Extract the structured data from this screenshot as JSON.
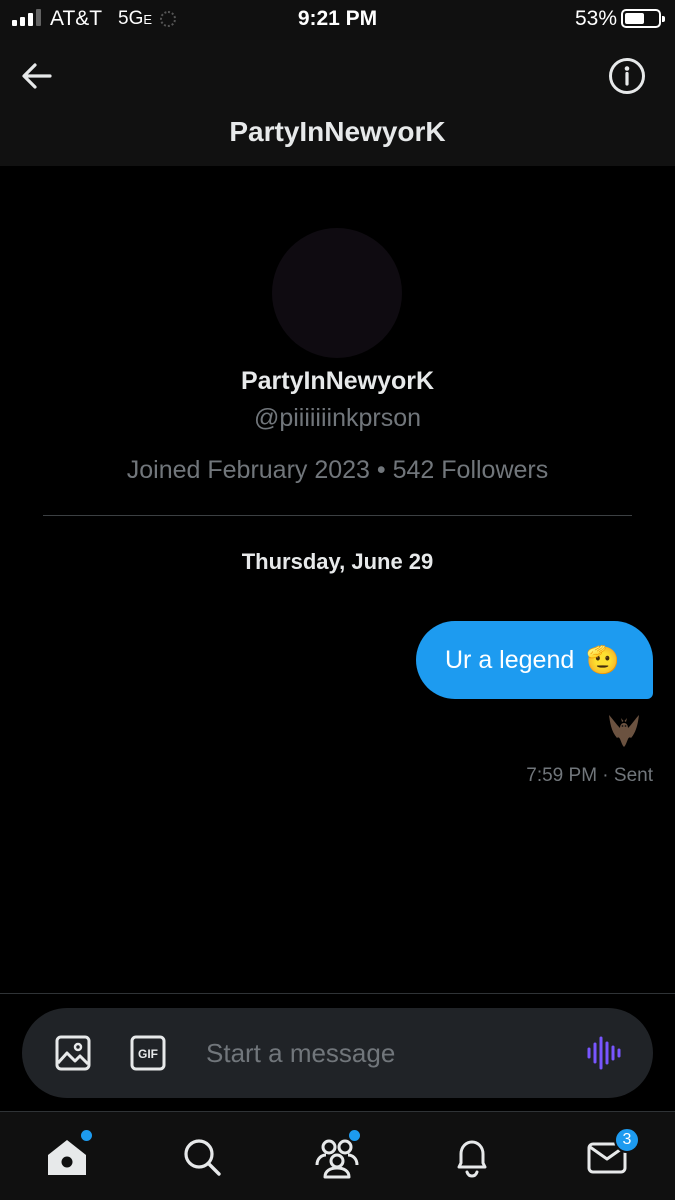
{
  "status_bar": {
    "carrier": "AT&T",
    "network": "5G",
    "network_suffix": "E",
    "time": "9:21 PM",
    "battery": "53%",
    "battery_level": 0.53
  },
  "header": {
    "title": "PartyInNewyorK"
  },
  "profile": {
    "name": "PartyInNewyorK",
    "handle": "@piiiiiiinkprson",
    "meta": "Joined February 2023 • 542 Followers"
  },
  "conversation": {
    "date": "Thursday, June 29",
    "messages": [
      {
        "text": "Ur a legend",
        "emoji": "🫡",
        "reaction": "bat-emoji",
        "status": "7:59 PM · Sent"
      }
    ]
  },
  "composer": {
    "placeholder": "Start a message",
    "gif_label": "GIF"
  },
  "nav": {
    "items": [
      "home-icon",
      "search-icon",
      "communities-icon",
      "notifications-icon",
      "messages-icon"
    ],
    "messages_badge": "3"
  },
  "colors": {
    "accent": "#1d9bf0",
    "background": "#000000",
    "muted_text": "#71767b",
    "voice_icon": "#7856ff"
  }
}
